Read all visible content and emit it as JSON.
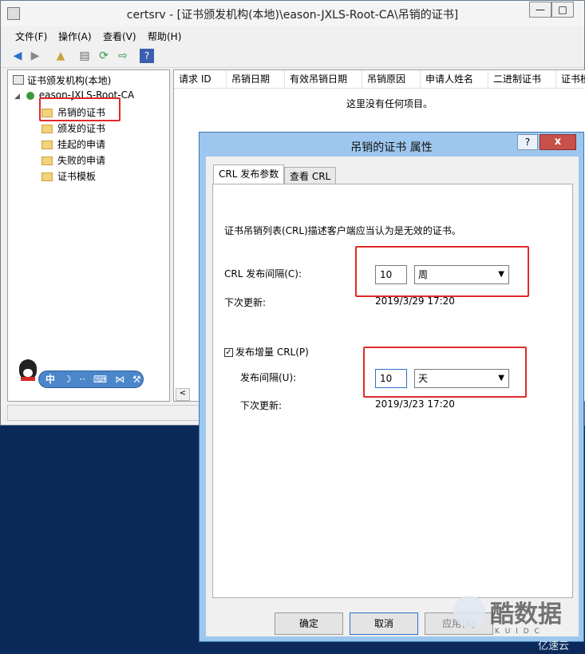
{
  "window": {
    "title": "certsrv - [证书颁发机构(本地)\\eason-JXLS-Root-CA\\吊销的证书]",
    "minimize": "—",
    "maximize": "□"
  },
  "menu": [
    "文件(F)",
    "操作(A)",
    "查看(V)",
    "帮助(H)"
  ],
  "tree": {
    "root": "证书颁发机构(本地)",
    "ca": "eason-JXLS-Root-CA",
    "items": [
      "吊销的证书",
      "颁发的证书",
      "挂起的申请",
      "失败的申请",
      "证书模板"
    ]
  },
  "list": {
    "columns": [
      "请求 ID",
      "吊销日期",
      "有效吊销日期",
      "吊销原因",
      "申请人姓名",
      "二进制证书",
      "证书模"
    ],
    "empty_text": "这里没有任何项目。"
  },
  "ime": {
    "label": "中"
  },
  "dialog": {
    "title": "吊销的证书 属性",
    "help": "?",
    "close": "x",
    "tabs": [
      "CRL 发布参数",
      "查看 CRL"
    ],
    "description": "证书吊销列表(CRL)描述客户端应当认为是无效的证书。",
    "crl_interval_label": "CRL 发布间隔(C):",
    "crl_interval_value": "10",
    "crl_interval_unit": "周",
    "next_update_label": "下次更新:",
    "next_update_value": "2019/3/29 17:20",
    "delta_checkbox_label": "发布增量 CRL(P)",
    "delta_checked": true,
    "delta_interval_label": "发布间隔(U):",
    "delta_interval_value": "10",
    "delta_interval_unit": "天",
    "delta_next_update_label": "下次更新:",
    "delta_next_update_value": "2019/3/23 17:20",
    "buttons": {
      "ok": "确定",
      "cancel": "取消",
      "apply": "应用(A)"
    }
  },
  "watermark": {
    "brand": "酷数据",
    "sub": "K U I D C",
    "site": "亿速云"
  },
  "colors": {
    "highlight_red": "#e02a2a",
    "dialog_frame": "#9dc7ee",
    "desktop": "#0b2a5a"
  }
}
